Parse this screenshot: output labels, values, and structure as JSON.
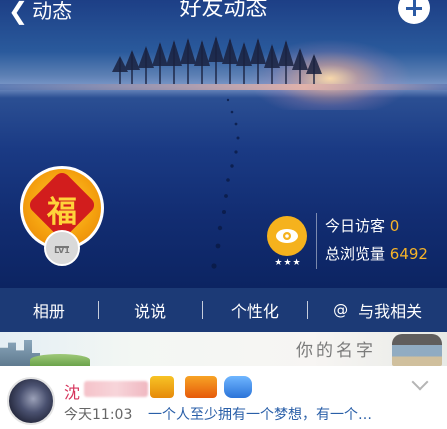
{
  "header": {
    "back_label": "动态",
    "title": "好友动态",
    "add_icon": "plus-icon"
  },
  "profile": {
    "avatar_char": "福",
    "level_label": "LV1",
    "stars": "★★★"
  },
  "stats": {
    "today_label": "今日访客",
    "today_value": "0",
    "total_label": "总浏览量",
    "total_value": "6492"
  },
  "tabs": [
    {
      "label": "相册"
    },
    {
      "label": "说说"
    },
    {
      "label": "个性化"
    },
    {
      "label": "与我相关",
      "icon": "at-icon"
    }
  ],
  "banner": {
    "watermark": "你的名字"
  },
  "post": {
    "name_visible": "沈",
    "time": "今天11:03",
    "text": "一个人至少拥有一个梦想，有一个…"
  },
  "colors": {
    "tab_bar": "#1c3a76",
    "accent_orange": "#f6b328",
    "name_pink": "#d6335b",
    "text_blue": "#2a5fa8"
  }
}
